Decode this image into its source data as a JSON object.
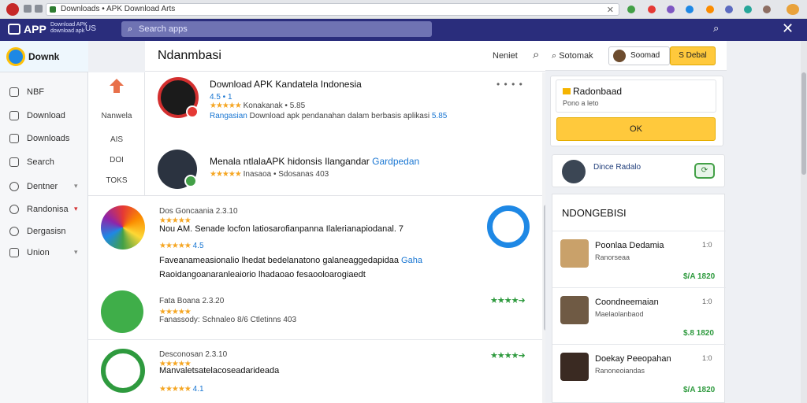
{
  "browser": {
    "url": "Downloads • APK Download Arts",
    "close_label": "✕"
  },
  "appbar": {
    "brand": "APP",
    "sub_line1": "Download APK",
    "sub_line2": "download apk",
    "sub_tag": "US",
    "search_placeholder": "Search apps"
  },
  "sidebar": {
    "brand": "Downk",
    "items": [
      {
        "label": "NBF"
      },
      {
        "label": "Download"
      },
      {
        "label": "Downloads"
      },
      {
        "label": "Search"
      },
      {
        "label": "Dentner",
        "chevron": "▾"
      },
      {
        "label": "Randonisa",
        "chevron": "▾"
      },
      {
        "label": "Dergasisn"
      },
      {
        "label": "Union",
        "chevron": "▾"
      }
    ]
  },
  "categories": [
    "Nanwela",
    "AIS",
    "DOI",
    "TOKS"
  ],
  "main": {
    "title": "Ndanmbasi",
    "newest": "Neniet",
    "featured": [
      {
        "title": "Download APK Kandatela Indonesia",
        "rating_text": "4.5 • 1",
        "stars": "★★★★★",
        "meta": "Konakanak • 5.85",
        "desc_link": "Rangasian",
        "desc": "Download apk pendanahan dalam berbasis aplikasi",
        "size": "5.85",
        "dots": "• • • •"
      },
      {
        "title": "Menala ntlalaAPK hidonsis Ilangandar",
        "title_link": "Gardpedan",
        "stars": "★★★★★",
        "meta": "Inasaoa • Sdosanas 403"
      }
    ]
  },
  "list": [
    {
      "l1": "Dos Goncaania 2.3.10",
      "stars": "★★★★★",
      "l2": "Nou AM. Senade locfon latiosarofianpanna Ilalerianapiodanal. 7",
      "rating": "4.5",
      "l4": "Faveanameasionalio lhedat bedelanatono galaneaggedapidaa",
      "l4_link": "Gaha",
      "l5": "Raoidangoanaranleaiorio lhadaoao fesaooloarogiaedt",
      "right_icon": "↗"
    },
    {
      "l1": "Fata Boana 2.3.20",
      "stars": "★★★★★",
      "l2": "Fanassody: Schnaleo 8/6 Ctletinns 403",
      "right_stars": "★★★★➜"
    },
    {
      "l1": "Desconosan 2.3.10",
      "stars": "★★★★★",
      "l2": "Manvaletsatelacoseadarideada",
      "rating": "4.1",
      "right_stars": "★★★★➜"
    }
  ],
  "right": {
    "topbar": {
      "label": "Sotomak",
      "sub_label": "Soomad",
      "detail_label": "S Debal"
    },
    "download": {
      "title": "Radonbaad",
      "sub": "Pono a leto",
      "ok_label": "OK"
    },
    "user": {
      "name": "Dince Radalo",
      "toggle_label": "⟳"
    },
    "recs_header": "NDONGEBISI",
    "recs": [
      {
        "name": "Poonlaa Dedamia",
        "desc": "Ranorseaa",
        "time": "1:0",
        "price": "$/A 1820",
        "color": "#c9a16a"
      },
      {
        "name": "Coondneemaian",
        "desc": "Maelaolanbaod",
        "time": "1:0",
        "price": "$.8 1820",
        "color": "#6f5a44"
      },
      {
        "name": "Doekay Peeopahan",
        "desc": "Ranoneoiandas",
        "time": "1:0",
        "price": "$/A 1820",
        "color": "#3a2a22"
      }
    ]
  }
}
